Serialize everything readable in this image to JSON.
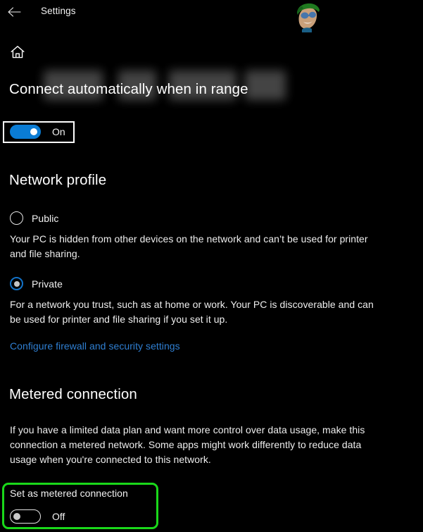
{
  "window": {
    "title": "Settings",
    "back_icon": "back-arrow-icon",
    "home_icon": "home-icon"
  },
  "breadcrumb": {
    "redacted": true,
    "segments": [
      "",
      "",
      "",
      ""
    ]
  },
  "watermark": {
    "name": "cartoon-avatar-watermark",
    "colors": {
      "hat": "#1f7a1f",
      "skin": "#c9a07a",
      "glasses": "#2f6fb5"
    }
  },
  "sections": {
    "connect_auto": {
      "heading": "Connect automatically when in range",
      "toggle": {
        "state_label": "On",
        "checked": true,
        "accent": "#0a7cd4"
      },
      "highlight": {
        "type": "rectangle",
        "color": "#ffffff"
      }
    },
    "network_profile": {
      "heading": "Network profile",
      "options": [
        {
          "label": "Public",
          "selected": false,
          "description": "Your PC is hidden from other devices on the network and can’t be used for printer and file sharing."
        },
        {
          "label": "Private",
          "selected": true,
          "description": "For a network you trust, such as at home or work. Your PC is discoverable and can be used for printer and file sharing if you set it up."
        }
      ],
      "link": {
        "label": "Configure firewall and security settings",
        "color": "#2f7fd2"
      }
    },
    "metered_connection": {
      "heading": "Metered connection",
      "description": "If you have a limited data plan and want more control over data usage, make this connection a metered network. Some apps might work differently to reduce data usage when you're connected to this network.",
      "setting_label": "Set as metered connection",
      "toggle": {
        "state_label": "Off",
        "checked": false
      },
      "highlight": {
        "type": "rounded-rectangle",
        "color": "#1ad81a"
      }
    }
  }
}
